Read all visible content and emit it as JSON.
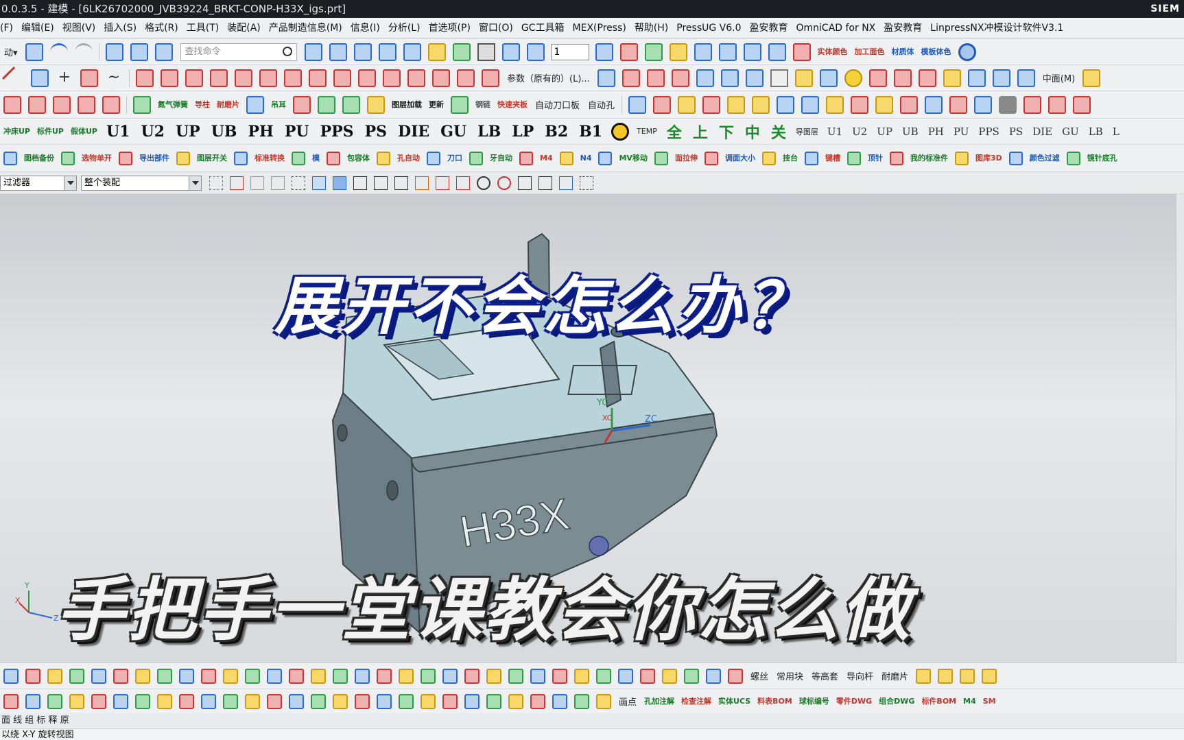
{
  "window": {
    "title": "0.0.3.5 - 建模 - [6LK26702000_JVB39224_BRKT-CONP-H33X_igs.prt]",
    "brand": "SIEM"
  },
  "menu": [
    "(F)",
    "编辑(E)",
    "视图(V)",
    "插入(S)",
    "格式(R)",
    "工具(T)",
    "装配(A)",
    "产品制造信息(M)",
    "信息(I)",
    "分析(L)",
    "首选项(P)",
    "窗口(O)",
    "GC工具箱",
    "MEX(Press)",
    "帮助(H)",
    "PressUG V6.0",
    "盈安教育",
    "OmniCAD for NX",
    "盈安教育",
    "LinpressNX冲模设计软件V3.1"
  ],
  "toolbar1": {
    "search_placeholder": "查找命令",
    "layer_value": "1",
    "labels": [
      "实体颜色",
      "加工面色",
      "材质体",
      "模板体色"
    ]
  },
  "toolbar2": {
    "texts": [
      "参数（原有的）(L)...",
      "中面(M)"
    ]
  },
  "toolbar3": {
    "texts": [
      "自动刀口板",
      "自动孔"
    ],
    "labels": [
      "氮气弹簧",
      "导柱",
      "耐磨片",
      "吊耳",
      "快速夹板",
      "图层加载",
      "更新",
      "钢链"
    ]
  },
  "toolbar4": {
    "codes": [
      "U1",
      "U2",
      "UP",
      "UB",
      "PH",
      "PU",
      "PPS",
      "PS",
      "DIE",
      "GU",
      "LB",
      "LP",
      "B2",
      "B1"
    ],
    "codes_small": [
      "U1",
      "U2",
      "UP",
      "UB",
      "PH",
      "PU",
      "PPS",
      "PS",
      "DIE",
      "GU",
      "LB",
      "L"
    ],
    "labels_left": [
      "冲床UP",
      "标件UP",
      "假体UP"
    ],
    "labels_mid": [
      "TEMP",
      "全",
      "上",
      "下",
      "中",
      "关",
      "导图层"
    ]
  },
  "toolbar5": {
    "labels": [
      "图档备份",
      "选物单开",
      "导出部件",
      "图层开关",
      "标准转换",
      "模",
      "包容体",
      "孔自动",
      "刀口",
      "牙自动",
      "M4",
      "N4",
      "MV移动",
      "面拉伸",
      "调面大小",
      "挂台",
      "键槽",
      "顶针",
      "我的标准件",
      "图库3D",
      "颜色过滤",
      "镜针底孔"
    ]
  },
  "toolbar6": {
    "filter": "过滤器",
    "assembly": "整个装配"
  },
  "overlay": {
    "headline": "展开不会怎么办？",
    "subline": "手把手一堂课教会你怎么做",
    "part_mark": "H33X"
  },
  "axes": {
    "yc": "YC",
    "xc": "XC",
    "zc": "ZC",
    "x": "X",
    "y": "Y",
    "z": "Z"
  },
  "bottombar1": {
    "texts": [
      "螺丝",
      "常用块",
      "等高套",
      "导向杆",
      "耐磨片"
    ]
  },
  "bottombar2": {
    "texts": [
      "画点"
    ],
    "labels": [
      "孔加注解",
      "检查注解",
      "实体UCS",
      "料表BOM",
      "球标编号",
      "零件DWG",
      "组合DWG",
      "标件BOM",
      "M4",
      "SM"
    ]
  },
  "bottombar3": {
    "text": "面 线 组 标 释 原"
  },
  "status": {
    "text": "以绕 X-Y 旋转视图"
  },
  "colors": {
    "headline_outline": "#0c1f8c",
    "part_body": "#6d7f86",
    "part_top": "#b9d3da",
    "viewport_bg": "#e6e8eb"
  }
}
